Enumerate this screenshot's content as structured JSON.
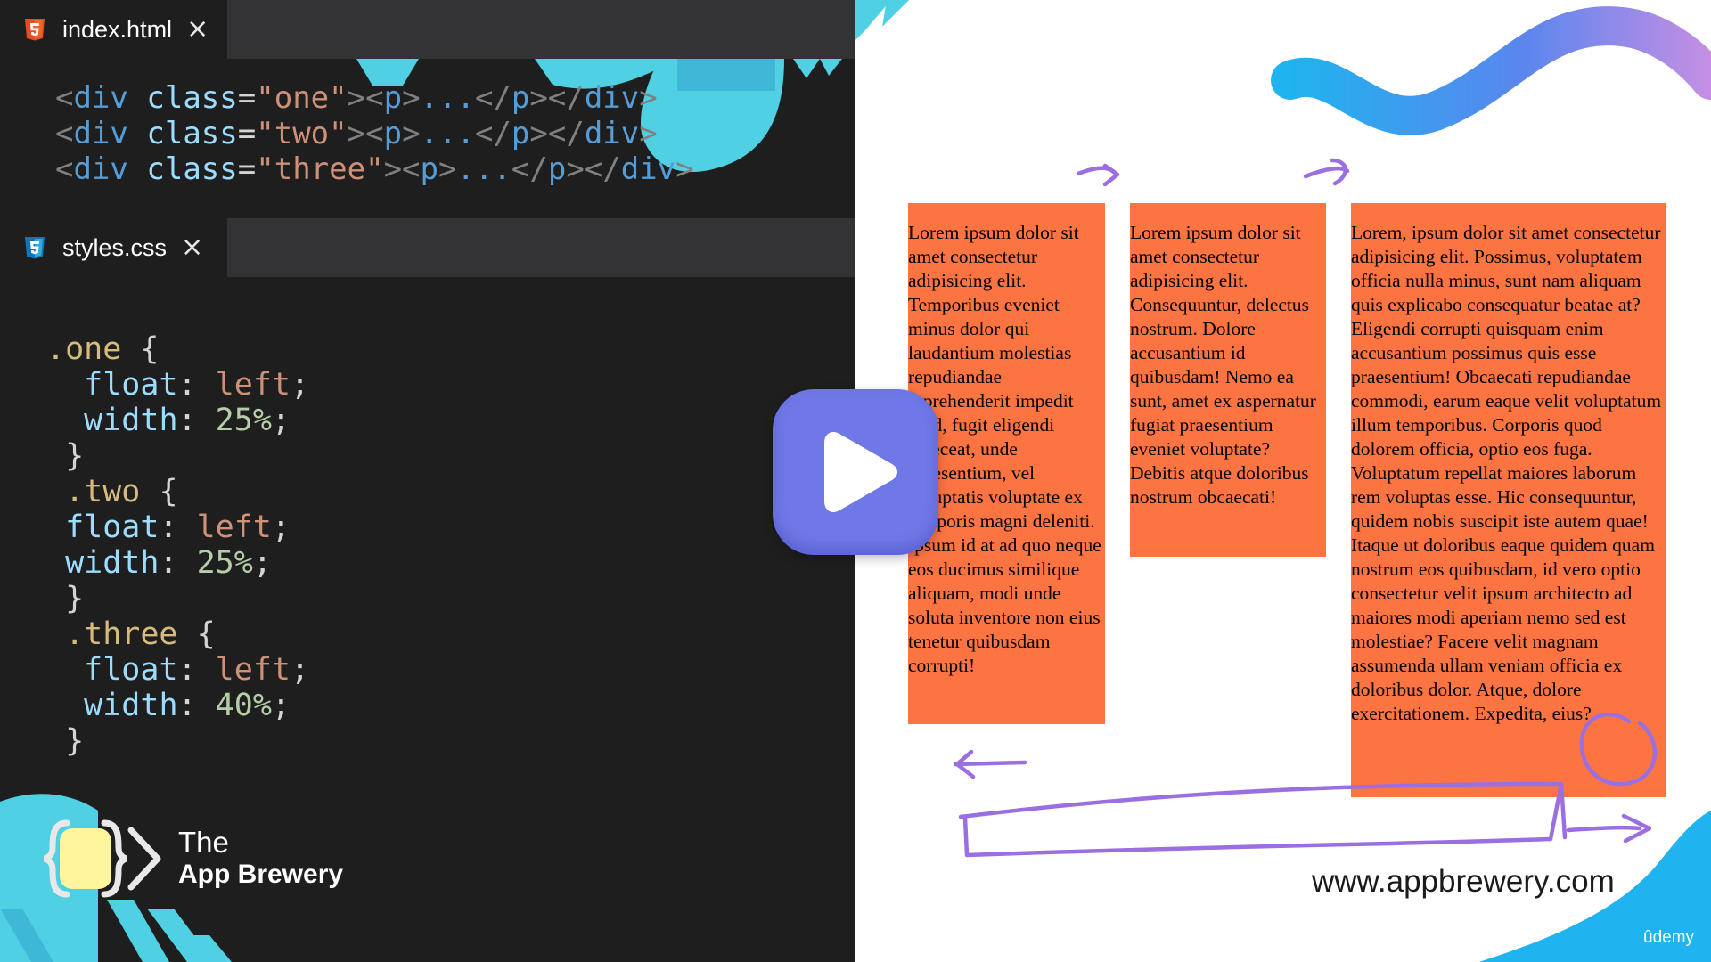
{
  "tabs": {
    "html_tab": {
      "label": "index.html",
      "close": "×"
    },
    "css_tab": {
      "label": "styles.css",
      "close": "×"
    }
  },
  "html_code": [
    {
      "cls": "one"
    },
    {
      "cls": "two"
    },
    {
      "cls": "three"
    }
  ],
  "html_tokens": {
    "open_div": "div",
    "class_attr": "class",
    "p_tag": "p",
    "ellipsis": "..."
  },
  "css_rules": [
    {
      "selector": ".one",
      "float_value": "left",
      "width_value": "25%"
    },
    {
      "selector": ".two",
      "float_value": "left",
      "width_value": "25%"
    },
    {
      "selector": ".three",
      "float_value": "left",
      "width_value": "40%"
    }
  ],
  "css_props": {
    "float": "float",
    "width": "width"
  },
  "brand": {
    "line1": "The",
    "line2": "App Brewery"
  },
  "preview": {
    "box_one_text": "Lorem ipsum dolor sit amet consectetur adipisicing elit. Temporibus eveniet minus dolor qui laudantium molestias repudiandae reprehenderit impedit quid, fugit eligendi deleceat, unde praesentium, vel voluptatis voluptate ex temporis magni deleniti. Ipsum id at ad quo neque eos ducimus similique aliquam, modi unde soluta inventore non eius tenetur quibusdam corrupti!",
    "box_two_text": "Lorem ipsum dolor sit amet consectetur adipisicing elit. Consequuntur, delectus nostrum. Dolore accusantium id quibusdam! Nemo ea sunt, amet ex aspernatur fugiat praesentium eveniet voluptate? Debitis atque doloribus nostrum obcaecati!",
    "box_three_text": "Lorem, ipsum dolor sit amet consectetur adipisicing elit. Possimus, voluptatem officia nulla minus, sunt nam aliquam quis explicabo consequatur beatae at? Eligendi corrupti quisquam enim accusantium possimus quis esse praesentium! Obcaecati repudiandae commodi, earum eaque velit voluptatum illum temporibus. Corporis quod dolorem officia, optio eos fuga. Voluptatum repellat maiores laborum rem voluptas esse. Hic consequuntur, quidem nobis suscipit iste autem quae! Itaque ut doloribus eaque quidem quam nostrum eos quibusdam, id vero optio consectetur velit ipsum architecto ad maiores modi aperiam nemo sed est molestiae? Facere velit magnam assumenda ullam veniam officia ex doloribus dolor. Atque, dolore exercitationem. Expedita, eius?",
    "url": "www.appbrewery.com",
    "watermark": "ûdemy"
  },
  "colors": {
    "editor_bg": "#1e1e1e",
    "box_orange": "#fd7443",
    "play_button": "#6e78e6",
    "annotation": "#9b6fe0",
    "accent_cyan": "#4fd1e3"
  },
  "icons": [
    "html5-file-icon",
    "css3-file-icon",
    "close-icon",
    "play-icon",
    "app-brewery-logo"
  ]
}
